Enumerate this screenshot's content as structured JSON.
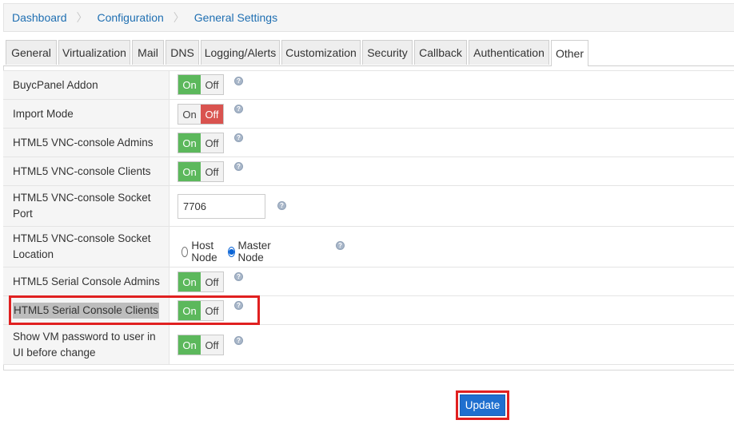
{
  "breadcrumb": [
    "Dashboard",
    "Configuration",
    "General Settings"
  ],
  "tabs": [
    "General",
    "Virtualization",
    "Mail",
    "DNS",
    "Logging/Alerts",
    "Customization",
    "Security",
    "Callback",
    "Authentication",
    "Other"
  ],
  "active_tab": "Other",
  "toggle_labels": {
    "on": "On",
    "off": "Off"
  },
  "help_glyph": "?",
  "settings": [
    {
      "label": "BuycPanel Addon",
      "state": "On"
    },
    {
      "label": "Import Mode",
      "state": "Off"
    },
    {
      "label": "HTML5 VNC-console Admins",
      "state": "On"
    },
    {
      "label": "HTML5 VNC-console Clients",
      "state": "On"
    },
    {
      "label": "HTML5 VNC-console Socket Port",
      "value": "7706"
    },
    {
      "label": "HTML5 VNC-console Socket Location",
      "options": [
        "Host Node",
        "Master Node"
      ],
      "selected": "Master Node"
    },
    {
      "label": "HTML5 Serial Console Admins",
      "state": "On"
    },
    {
      "label": "HTML5 Serial Console Clients",
      "state": "On"
    },
    {
      "label": "Show VM password to user in UI before change",
      "state": "On"
    }
  ],
  "update_label": "Update",
  "colors": {
    "on": "#5cb85c",
    "off": "#d9534f",
    "link": "#1f6fb2",
    "button": "#1f6fcf",
    "highlight": "#e02020"
  }
}
